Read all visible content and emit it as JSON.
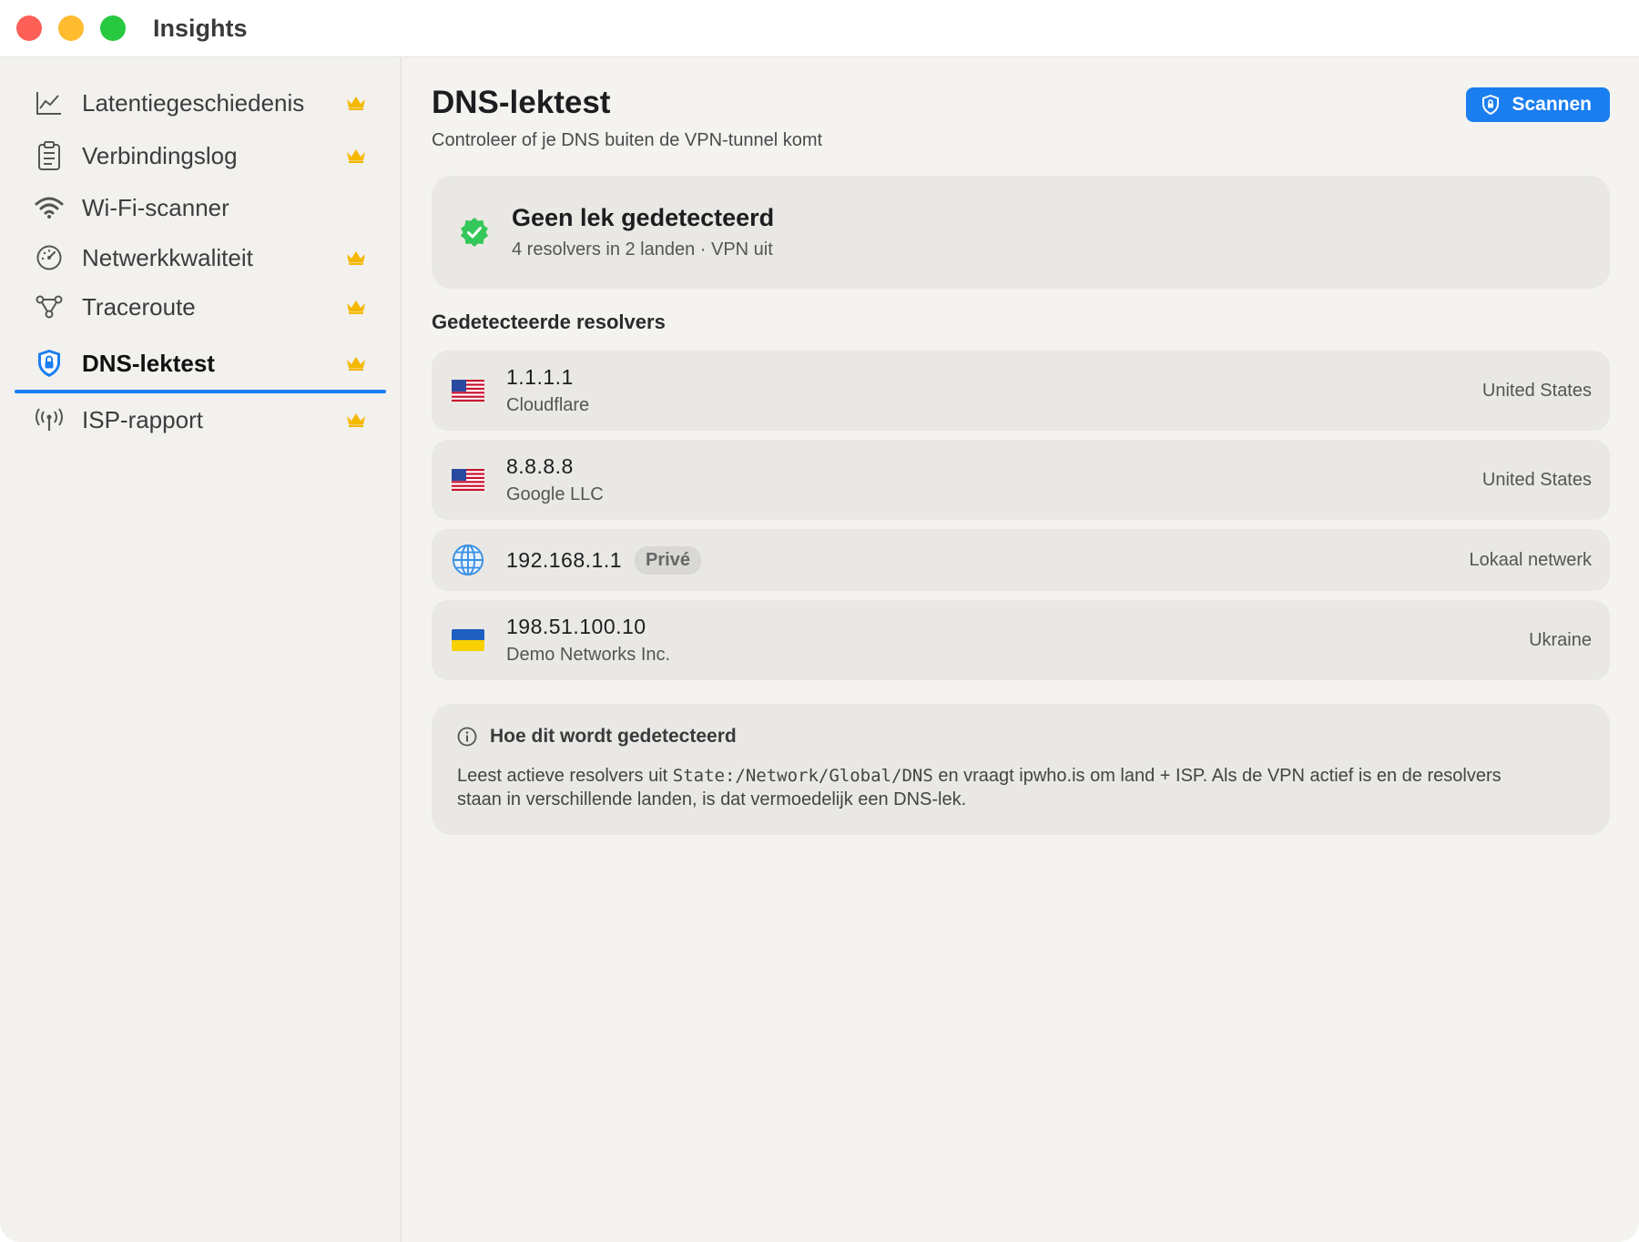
{
  "window": {
    "title": "Insights"
  },
  "sidebar": {
    "items": [
      {
        "label": "Latentiegeschiedenis",
        "icon": "chart-line-icon",
        "premium": true
      },
      {
        "label": "Verbindingslog",
        "icon": "clipboard-icon",
        "premium": true
      },
      {
        "label": "Wi-Fi-scanner",
        "icon": "wifi-icon",
        "premium": false
      },
      {
        "label": "Netwerkkwaliteit",
        "icon": "gauge-icon",
        "premium": true
      },
      {
        "label": "Traceroute",
        "icon": "network-nodes-icon",
        "premium": true
      },
      {
        "label": "DNS-lektest",
        "icon": "shield-lock-icon",
        "premium": true,
        "active": true
      },
      {
        "label": "ISP-rapport",
        "icon": "antenna-icon",
        "premium": true
      }
    ]
  },
  "main": {
    "title": "DNS-lektest",
    "subtitle": "Controleer of je DNS buiten de VPN-tunnel komt",
    "scan_button": "Scannen",
    "status": {
      "title": "Geen lek gedetecteerd",
      "subtitle": "4 resolvers in 2 landen · VPN uit",
      "color": "#34c759"
    },
    "resolvers_heading": "Gedetecteerde resolvers",
    "resolvers": [
      {
        "ip": "1.1.1.1",
        "provider": "Cloudflare",
        "country": "United States",
        "flag": "us-flag"
      },
      {
        "ip": "8.8.8.8",
        "provider": "Google LLC",
        "country": "United States",
        "flag": "us-flag"
      },
      {
        "ip": "192.168.1.1",
        "badge": "Privé",
        "country": "Lokaal netwerk",
        "flag": "globe-icon"
      },
      {
        "ip": "198.51.100.10",
        "provider": "Demo Networks Inc.",
        "country": "Ukraine",
        "flag": "ua-flag"
      }
    ],
    "info": {
      "title": "Hoe dit wordt gedetecteerd",
      "body_before": "Leest actieve resolvers uit ",
      "body_code": "State:/Network/Global/DNS",
      "body_after": " en vraagt ipwho.is om land + ISP. Als de VPN actief is en de resolvers staan in verschillende landen, is dat vermoedelijk een DNS-lek."
    }
  },
  "colors": {
    "accent": "#1a7ef0",
    "crown": "#f5b800",
    "success": "#34c759"
  }
}
